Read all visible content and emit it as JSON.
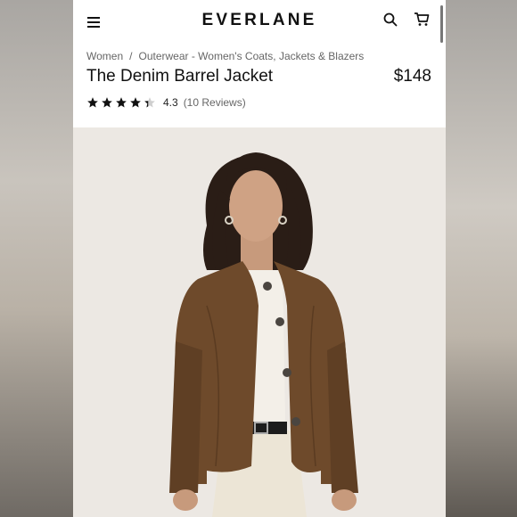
{
  "header": {
    "brand": "EVERLANE",
    "menu_icon": "hamburger-menu-icon",
    "search_icon": "search-icon",
    "cart_icon": "cart-icon"
  },
  "breadcrumb": {
    "level1": "Women",
    "separator": "/",
    "level2": "Outerwear - Women's Coats, Jackets & Blazers"
  },
  "product": {
    "title": "The Denim Barrel Jacket",
    "price": "$148",
    "rating_value": "4.3",
    "reviews_label": "(10 Reviews)",
    "stars_filled": 4.3,
    "stars_total": 5
  },
  "colors": {
    "jacket": "#6e4a2b",
    "background": "#ece8e3",
    "text": "#111111"
  }
}
